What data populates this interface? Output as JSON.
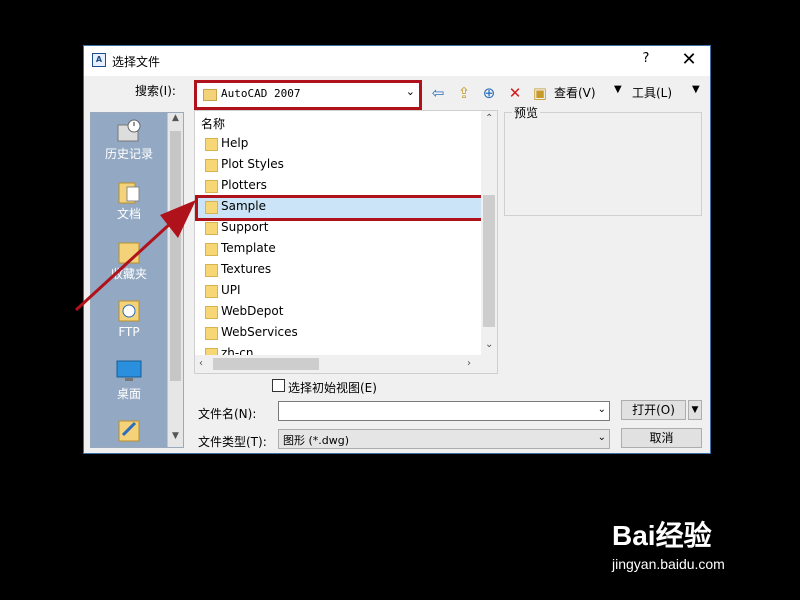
{
  "window": {
    "title": "选择文件",
    "help": "?",
    "close": "✕",
    "app_icon": "A"
  },
  "toolbar": {
    "search_label": "搜索(I):",
    "lookin_value": "AutoCAD 2007",
    "view_label": "查看(V)",
    "tools_label": "工具(L)",
    "icons": [
      "back-arrow-icon",
      "up-folder-icon",
      "search-web-icon",
      "delete-icon",
      "new-folder-icon"
    ]
  },
  "places": [
    {
      "label": "历史记录",
      "icon": "history-icon"
    },
    {
      "label": "文档",
      "icon": "documents-icon"
    },
    {
      "label": "收藏夹",
      "icon": "favorites-icon"
    },
    {
      "label": "FTP",
      "icon": "ftp-icon"
    },
    {
      "label": "桌面",
      "icon": "desktop-icon"
    },
    {
      "label": "",
      "icon": "buzzsaw-icon"
    }
  ],
  "filelist": {
    "header": "名称",
    "items": [
      "Help",
      "Plot Styles",
      "Plotters",
      "Sample",
      "Support",
      "Template",
      "Textures",
      "UPI",
      "WebDepot",
      "WebServices",
      "zh-cn"
    ],
    "selected": "Sample"
  },
  "preview": {
    "label": "预览"
  },
  "options": {
    "initial_view_label": "选择初始视图(E)"
  },
  "form": {
    "filename_label": "文件名(N):",
    "filename_value": "",
    "filetype_label": "文件类型(T):",
    "filetype_value": "图形 (*.dwg)",
    "open_label": "打开(O)",
    "cancel_label": "取消"
  },
  "watermark": {
    "logo": "Bai经验",
    "url": "jingyan.baidu.com"
  },
  "colors": {
    "highlight": "#b0121b",
    "places_bg": "#93a9c3",
    "selection": "#cce4f7"
  }
}
